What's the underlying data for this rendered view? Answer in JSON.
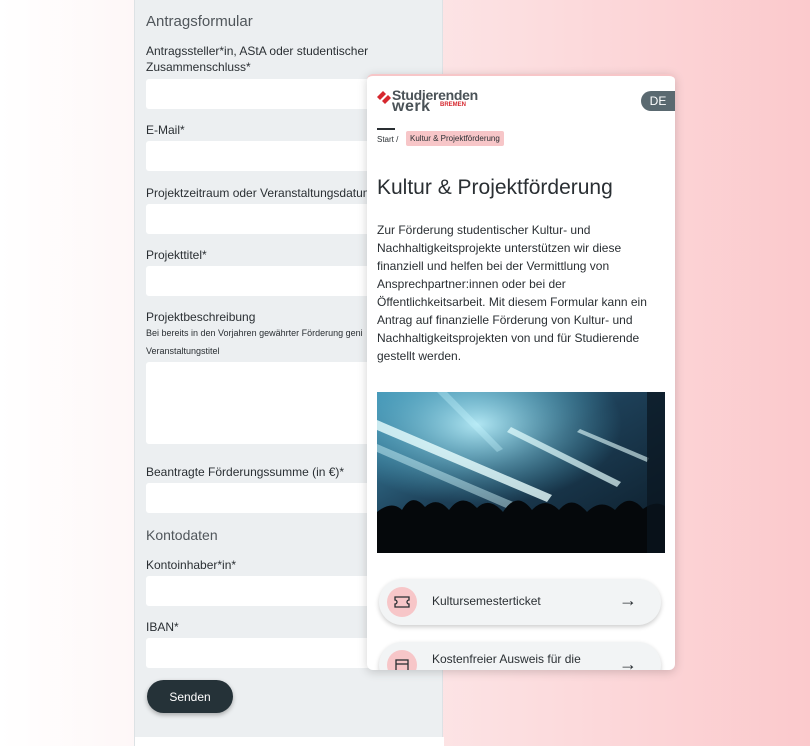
{
  "form": {
    "title": "Antragsformular",
    "fields": [
      {
        "label": "Antragssteller*in, AStA oder studentischer Zusammenschluss*"
      },
      {
        "label": "E-Mail*"
      },
      {
        "label": "Projektzeitraum oder Veranstaltungsdatum*"
      },
      {
        "label": "Projekttitel*"
      },
      {
        "label": "Projektbeschreibung",
        "hint": "Bei bereits in den Vorjahren gewährter Förderung geni... Veranstaltungstitel"
      },
      {
        "label": "Beantragte Förderungssumme (in €)*"
      }
    ],
    "hint_line1": "Bei bereits in den Vorjahren gewährter Förderung geni",
    "hint_line2": "Veranstaltungstitel",
    "section_account": "Kontodaten",
    "account_fields": [
      {
        "label": "Kontoinhaber*in*"
      },
      {
        "label": "IBAN*"
      }
    ],
    "submit_label": "Senden"
  },
  "mobile": {
    "logo": {
      "line1": "Studierenden",
      "line2": "werk",
      "city": "BREMEN"
    },
    "language": "DE",
    "breadcrumb": {
      "start": "Start /",
      "current": "Kultur & Projektförderung"
    },
    "title": "Kultur & Projektförderung",
    "intro": "Zur Förderung studentischer Kultur- und Nachhaltigkeitsprojekte unterstützen wir diese finanziell und helfen bei der Vermittlung von Ansprechpartner:innen oder bei der Öffentlichkeitsarbeit. Mit diesem Formular kann ein Antrag auf finanzielle Förderung von Kultur- und Nachhaltigkeitsprojekten von und für Studierende gestellt werden.",
    "links": [
      {
        "label": "Kultursemesterticket",
        "icon": "ticket-icon",
        "arrow": "→"
      },
      {
        "label": "Kostenfreier Ausweis für die",
        "icon": "id-card-icon",
        "arrow": "→"
      }
    ]
  },
  "colors": {
    "accent": "#f7c6c8",
    "dark": "#253238",
    "brand_red": "#d6282f"
  }
}
